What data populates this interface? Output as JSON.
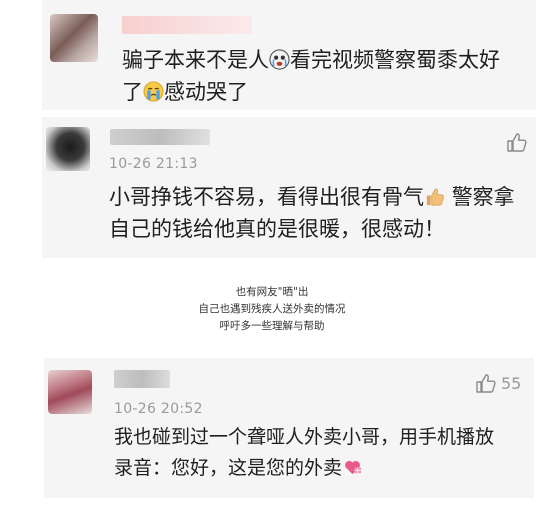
{
  "comments": [
    {
      "text_line1": "骗子本来不是人",
      "emoji1": "crying-face-emoji",
      "text_line1b": "看完视频警察蜀黍太好",
      "text_line2": "了",
      "emoji2": "crying-face-emoji",
      "text_line2b": "感动哭了"
    },
    {
      "time": "10-26 21:13",
      "text_line1": "小哥挣钱不容易，看得出很有骨气",
      "emoji1": "thumbs-up-emoji",
      "text_line1b": "警察拿",
      "text_line2": "自己的钱给他真的是很暖，很感动！",
      "like_icon": "thumbs-up-icon"
    },
    {
      "time": "10-26 20:52",
      "text_line1": "我也碰到过一个聋哑人外卖小哥，用手机播放",
      "text_line2": "录音：您好，这是您的外卖",
      "emoji2": "heart-gift-emoji",
      "like_icon": "thumbs-up-icon",
      "like_count": "55"
    }
  ],
  "caption": {
    "line1": "也有网友\"晒\"出",
    "line2": "自己也遇到残疾人送外卖的情况",
    "line3": "呼吁多一些理解与帮助"
  },
  "colors": {
    "card_bg": "#f5f5f5",
    "time_text": "#9a9a9a",
    "username_blur": "#f4c7c7"
  }
}
